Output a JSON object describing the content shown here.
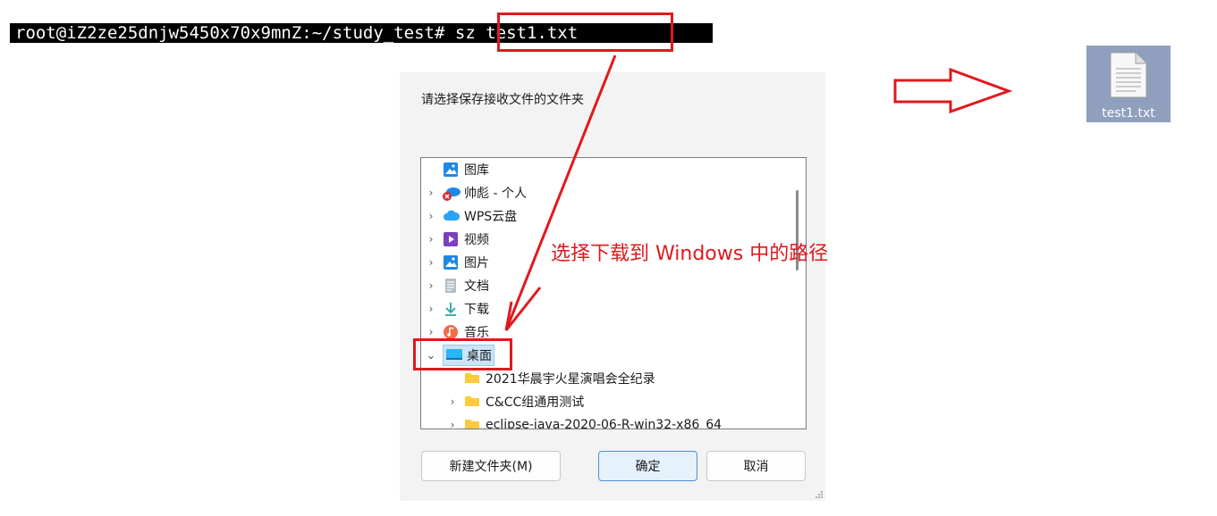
{
  "terminal": {
    "prompt": "root@iZ2ze25dnjw5450x70x9mnZ:~/study_test#",
    "command": " sz test1.txt"
  },
  "dialog": {
    "prompt": "请选择保存接收文件的文件夹",
    "tree_items": [
      {
        "label": "图库",
        "icon": "gallery-icon",
        "expandable": false
      },
      {
        "label": "帅彪 - 个人",
        "icon": "onedrive-error-icon",
        "expandable": true
      },
      {
        "label": "WPS云盘",
        "icon": "cloud-icon",
        "expandable": true
      },
      {
        "label": "视频",
        "icon": "video-folder-icon",
        "expandable": true
      },
      {
        "label": "图片",
        "icon": "pictures-folder-icon",
        "expandable": true
      },
      {
        "label": "文档",
        "icon": "documents-folder-icon",
        "expandable": true
      },
      {
        "label": "下载",
        "icon": "download-icon",
        "expandable": true
      },
      {
        "label": "音乐",
        "icon": "music-icon",
        "expandable": true
      },
      {
        "label": "桌面",
        "icon": "desktop-icon",
        "expandable": true,
        "expanded": true,
        "selected": true
      },
      {
        "label": "2021华晨宇火星演唱会全纪录",
        "icon": "folder-icon",
        "expandable": false
      },
      {
        "label": "C&CC组通用测试",
        "icon": "folder-icon",
        "expandable": true
      },
      {
        "label": "eclipse-java-2020-06-R-win32-x86_64",
        "icon": "folder-icon",
        "expandable": true
      }
    ],
    "buttons": {
      "new_folder": "新建文件夹(M)",
      "ok": "确定",
      "cancel": "取消"
    }
  },
  "annotation": "选择下载到 Windows 中的路径",
  "desktop_file": {
    "name": "test1.txt",
    "icon": "text-file-icon"
  },
  "colors": {
    "annotation_red": "#e0191d",
    "selection_blue": "#cce4f7",
    "primary_border": "#4a90d9"
  }
}
